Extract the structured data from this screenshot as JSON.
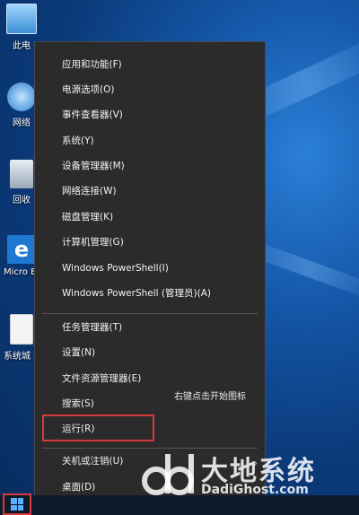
{
  "desktop": {
    "icons": [
      {
        "label": "此电"
      },
      {
        "label": "网络"
      },
      {
        "label": "回收"
      },
      {
        "label": "Micro Edg"
      },
      {
        "label": "系统城 布"
      }
    ]
  },
  "context_menu": {
    "group1": [
      "应用和功能(F)",
      "电源选项(O)",
      "事件查看器(V)",
      "系统(Y)",
      "设备管理器(M)",
      "网络连接(W)",
      "磁盘管理(K)",
      "计算机管理(G)",
      "Windows PowerShell(I)",
      "Windows PowerShell (管理员)(A)"
    ],
    "group2": [
      "任务管理器(T)",
      "设置(N)",
      "文件资源管理器(E)",
      "搜索(S)",
      "运行(R)"
    ],
    "group3": [
      "关机或注销(U)",
      "桌面(D)"
    ]
  },
  "annotation": "右键点击开始图标",
  "watermark": {
    "cn": "大地系统",
    "en": "DadiGhost.com"
  },
  "colors": {
    "menu_bg": "#2b2b2b",
    "highlight": "#d63a3a",
    "accent": "#5ab0ff"
  }
}
